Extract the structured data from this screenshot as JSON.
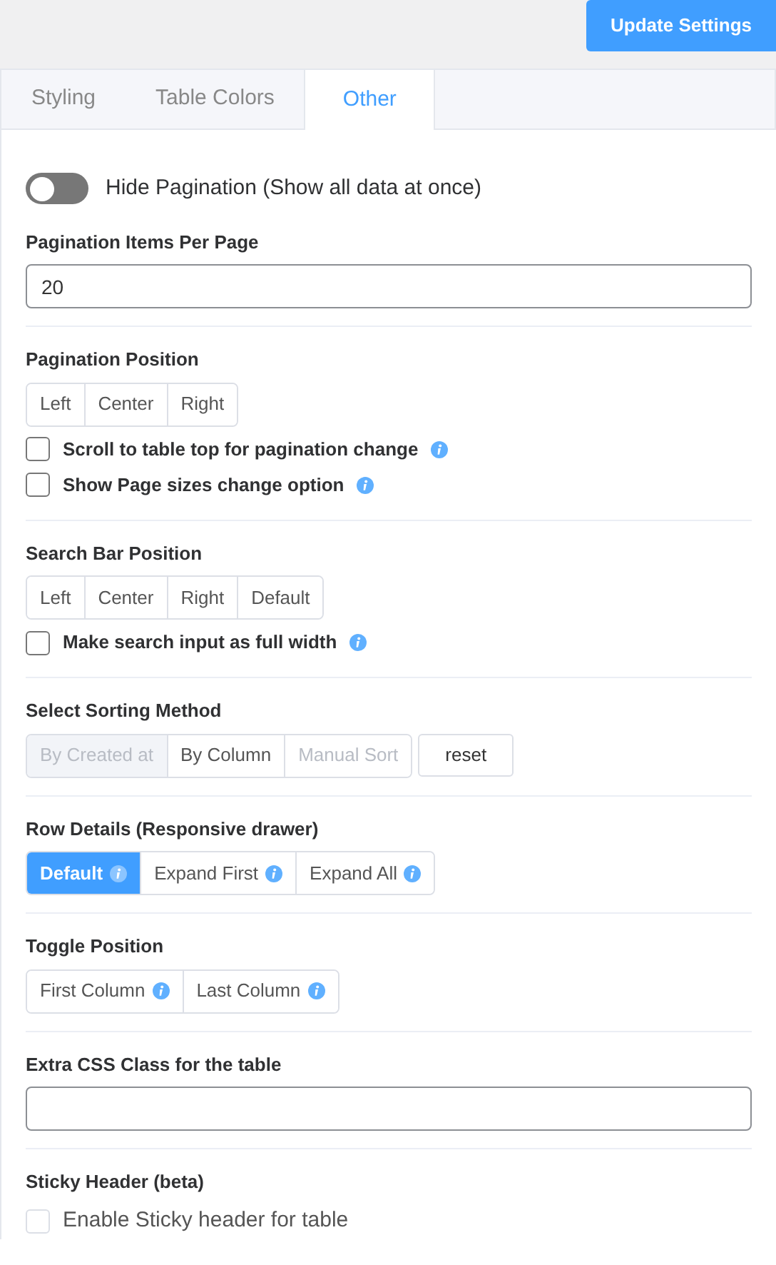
{
  "header": {
    "button": "Update Settings"
  },
  "tabs": [
    {
      "label": "Styling",
      "selected": false
    },
    {
      "label": "Table Colors",
      "selected": false
    },
    {
      "label": "Other",
      "selected": true
    }
  ],
  "hide_pagination": {
    "label": "Hide Pagination (Show all data at once)",
    "on": false
  },
  "sections": [
    {
      "kind": "input",
      "title": "Pagination Items Per Page",
      "value": "20"
    },
    {
      "kind": "group",
      "title": "Pagination Position",
      "segments": [
        {
          "label": "Left",
          "selected": false,
          "disabled": false,
          "info": false
        },
        {
          "label": "Center",
          "selected": false,
          "disabled": false,
          "info": false
        },
        {
          "label": "Right",
          "selected": false,
          "disabled": false,
          "info": false
        }
      ],
      "checkboxes": [
        {
          "label": "Scroll to table top for pagination change",
          "checked": false,
          "info": true
        },
        {
          "label": "Show Page sizes change option",
          "checked": false,
          "info": true
        }
      ]
    },
    {
      "kind": "group",
      "title": "Search Bar Position",
      "segments": [
        {
          "label": "Left",
          "selected": false,
          "disabled": false,
          "info": false
        },
        {
          "label": "Center",
          "selected": false,
          "disabled": false,
          "info": false
        },
        {
          "label": "Right",
          "selected": false,
          "disabled": false,
          "info": false
        },
        {
          "label": "Default",
          "selected": false,
          "disabled": false,
          "info": false
        }
      ],
      "checkboxes": [
        {
          "label": "Make search input as full width",
          "checked": false,
          "info": true
        }
      ]
    },
    {
      "kind": "group",
      "title": "Select Sorting Method",
      "segments": [
        {
          "label": "By Created at",
          "selected": false,
          "disabled": true,
          "info": false
        },
        {
          "label": "By Column",
          "selected": false,
          "disabled": false,
          "info": false
        },
        {
          "label": "Manual Sort",
          "selected": false,
          "disabled": true,
          "info": false
        }
      ],
      "reset": "reset"
    },
    {
      "kind": "group",
      "title": "Row Details (Responsive drawer)",
      "segments": [
        {
          "label": "Default",
          "selected": true,
          "disabled": false,
          "info": true
        },
        {
          "label": "Expand First",
          "selected": false,
          "disabled": false,
          "info": true
        },
        {
          "label": "Expand All",
          "selected": false,
          "disabled": false,
          "info": true
        }
      ]
    },
    {
      "kind": "group",
      "title": "Toggle Position",
      "segments": [
        {
          "label": "First Column",
          "selected": false,
          "disabled": false,
          "info": true
        },
        {
          "label": "Last Column",
          "selected": false,
          "disabled": false,
          "info": true
        }
      ]
    },
    {
      "kind": "input",
      "title": "Extra CSS Class for the table"
    },
    {
      "kind": "sticky",
      "title": "Sticky Header (beta)",
      "checkboxes": [
        {
          "label": "Enable Sticky header for table",
          "checked": false,
          "info": false
        }
      ]
    }
  ]
}
